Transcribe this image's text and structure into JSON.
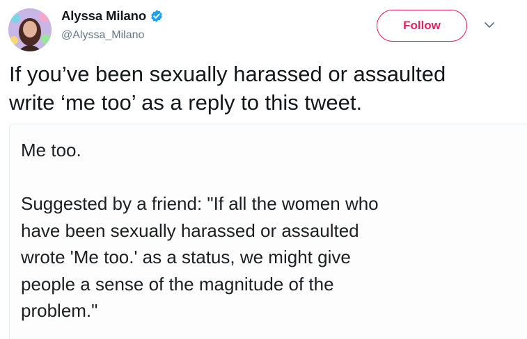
{
  "author": {
    "display_name": "Alyssa Milano",
    "handle": "@Alyssa_Milano",
    "verified": true,
    "avatar_icon": "profile-photo"
  },
  "actions": {
    "follow_label": "Follow",
    "menu_icon": "chevron-down-icon"
  },
  "tweet": {
    "text": "If you’ve been sexually harassed or assaulted\nwrite ‘me too’ as a reply to this tweet."
  },
  "attached_image": {
    "line1": "Me too.",
    "body": "Suggested by a friend: \"If all the women who\nhave been sexually harassed or assaulted\nwrote 'Me too.' as a status, we might give\npeople a sense of the magnitude of the\nproblem.\""
  },
  "colors": {
    "follow_accent": "#e0245e",
    "verified_badge": "#1da1f2",
    "secondary_text": "#657786"
  }
}
